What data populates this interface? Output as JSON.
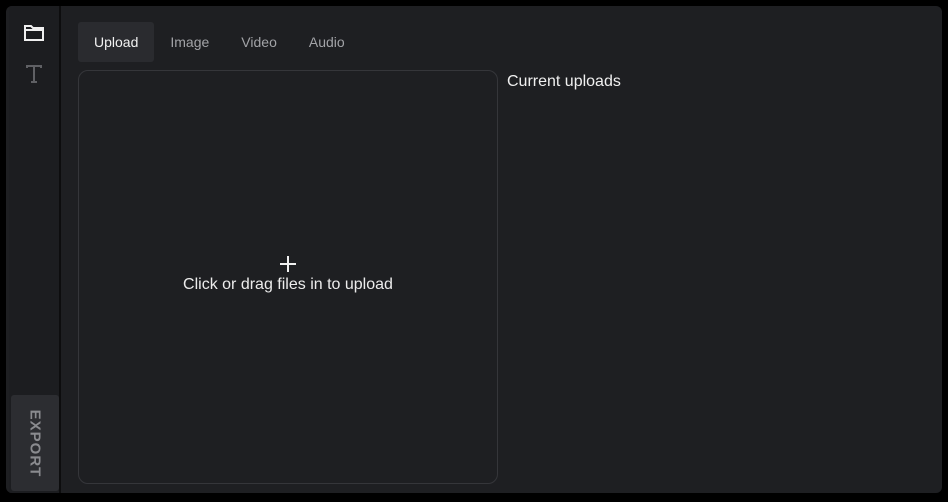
{
  "sidebar": {
    "icons": [
      {
        "name": "folder-icon",
        "active": true
      },
      {
        "name": "text-icon",
        "active": false
      }
    ],
    "export_label": "EXPORT"
  },
  "tabs": [
    {
      "label": "Upload",
      "active": true
    },
    {
      "label": "Image",
      "active": false
    },
    {
      "label": "Video",
      "active": false
    },
    {
      "label": "Audio",
      "active": false
    }
  ],
  "dropzone": {
    "text": "Click or drag files in to upload"
  },
  "uploads": {
    "title": "Current uploads"
  },
  "colors": {
    "background": "#1e1f22",
    "sidebar": "#1c1d20",
    "active_tab": "#2a2b2f",
    "export_button": "#2c2d31",
    "text_primary": "#f0f0f0",
    "text_muted": "#a2a3a7"
  }
}
